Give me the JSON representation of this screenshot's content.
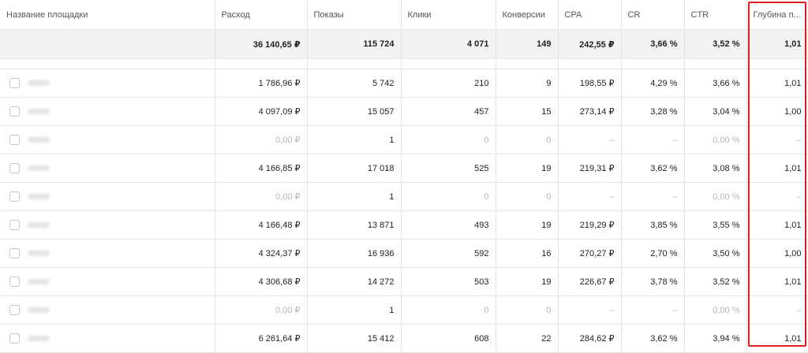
{
  "columns": [
    "Название площадки",
    "Расход",
    "Показы",
    "Клики",
    "Конверсии",
    "CPA",
    "CR",
    "CTR",
    "Глубина п..."
  ],
  "totals": [
    "36 140,65 ₽",
    "115 724",
    "4 071",
    "149",
    "242,55 ₽",
    "3,66 %",
    "3,52 %",
    "1,01"
  ],
  "rows": [
    {
      "zero": false,
      "cells": [
        "1 786,96 ₽",
        "5 742",
        "210",
        "9",
        "198,55 ₽",
        "4,29 %",
        "3,66 %",
        "1,01"
      ]
    },
    {
      "zero": false,
      "cells": [
        "4 097,09 ₽",
        "15 057",
        "457",
        "15",
        "273,14 ₽",
        "3,28 %",
        "3,04 %",
        "1,00"
      ]
    },
    {
      "zero": true,
      "cells": [
        "0,00 ₽",
        "1",
        "0",
        "0",
        "–",
        "–",
        "0,00 %",
        "–"
      ]
    },
    {
      "zero": false,
      "cells": [
        "4 166,85 ₽",
        "17 018",
        "525",
        "19",
        "219,31 ₽",
        "3,62 %",
        "3,08 %",
        "1,01"
      ]
    },
    {
      "zero": true,
      "cells": [
        "0,00 ₽",
        "1",
        "0",
        "0",
        "–",
        "–",
        "0,00 %",
        "–"
      ]
    },
    {
      "zero": false,
      "cells": [
        "4 166,48 ₽",
        "13 871",
        "493",
        "19",
        "219,29 ₽",
        "3,85 %",
        "3,55 %",
        "1,01"
      ]
    },
    {
      "zero": false,
      "cells": [
        "4 324,37 ₽",
        "16 936",
        "592",
        "16",
        "270,27 ₽",
        "2,70 %",
        "3,50 %",
        "1,00"
      ]
    },
    {
      "zero": false,
      "cells": [
        "4 306,68 ₽",
        "14 272",
        "503",
        "19",
        "226,67 ₽",
        "3,78 %",
        "3,52 %",
        "1,01"
      ]
    },
    {
      "zero": true,
      "cells": [
        "0,00 ₽",
        "1",
        "0",
        "0",
        "–",
        "–",
        "0,00 %",
        "–"
      ]
    },
    {
      "zero": false,
      "cells": [
        "6 261,64 ₽",
        "15 412",
        "608",
        "22",
        "284,62 ₽",
        "3,62 %",
        "3,94 %",
        "1,01"
      ]
    }
  ],
  "colors": {
    "highlight": "#e02020",
    "total_bg": "#f3f3f3",
    "border": "#e6e6e6"
  },
  "icons": {
    "row_checkbox": "checkbox-icon",
    "site_name": "blurred-site-name"
  }
}
